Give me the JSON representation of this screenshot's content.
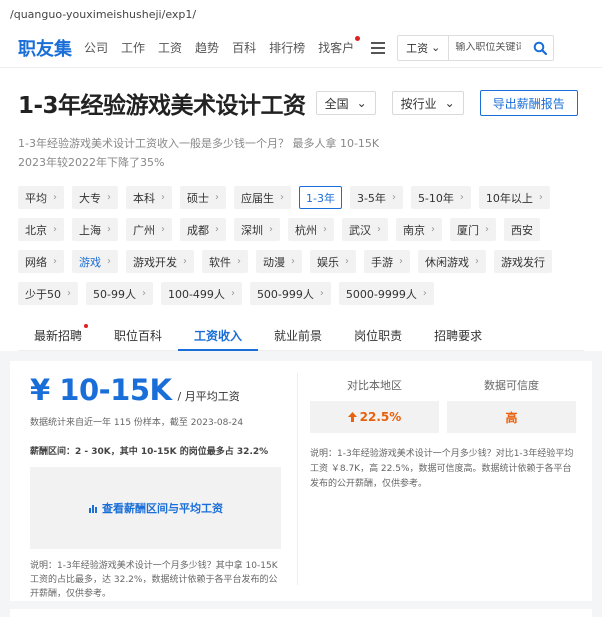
{
  "url": "/quanguo-youximeishusheji/exp1/",
  "nav": {
    "logo": "职友集",
    "items": [
      "公司",
      "工作",
      "工资",
      "趋势",
      "百科",
      "排行榜",
      "找客户"
    ],
    "search_type": "工资",
    "search_placeholder": "输入职位关键词"
  },
  "header": {
    "title": "1-3年经验游戏美术设计工资",
    "region": "全国",
    "industry": "按行业",
    "export_label": "导出薪酬报告",
    "desc1": "1-3年经验游戏美术设计工资收入一般是多少钱一个月？ 最多人拿 10-15K",
    "desc2": "2023年较2022年下降了35%"
  },
  "filters": {
    "education": [
      "平均",
      "大专",
      "本科",
      "硕士",
      "应届生",
      "1-3年",
      "3-5年",
      "5-10年",
      "10年以上"
    ],
    "cities": [
      "北京",
      "上海",
      "广州",
      "成都",
      "深圳",
      "杭州",
      "武汉",
      "南京",
      "厦门",
      "西安"
    ],
    "industries": [
      "网络",
      "游戏",
      "游戏开发",
      "软件",
      "动漫",
      "娱乐",
      "手游",
      "休闲游戏",
      "游戏发行"
    ],
    "sizes": [
      "少于50",
      "50-99人",
      "100-499人",
      "500-999人",
      "5000-9999人"
    ]
  },
  "tabs": [
    "最新招聘",
    "职位百科",
    "工资收入",
    "就业前景",
    "岗位职责",
    "招聘要求"
  ],
  "salary": {
    "value": "¥ 10-15K",
    "unit": "/ 月平均工资",
    "stats_note": "数据统计来自近一年 115 份样本，截至 2023-08-24",
    "range_note": "薪酬区间：2 - 30K，其中 10-15K 的岗位最多占 32.2%",
    "chart_link": "查看薪酬区间与平均工资",
    "note": "说明：1-3年经验游戏美术设计一个月多少钱？其中拿 10-15K 工资的占比最多，达 32.2%，数据统计依赖于各平台发布的公开薪酬，仅供参考。"
  },
  "compare": {
    "head1": "对比本地区",
    "head2": "数据可信度",
    "val1": "22.5%",
    "val2": "高",
    "note": "说明：1-3年经验游戏美术设计一个月多少钱？对比1-3年经验平均工资 ￥8.7K，高 22.5%，数据可信度高。数据统计依赖于各平台发布的公开薪酬，仅供参考。"
  },
  "colors": {
    "accent": "#1a6ed8",
    "orange": "#e8610c",
    "red_dot": "#e02020"
  }
}
